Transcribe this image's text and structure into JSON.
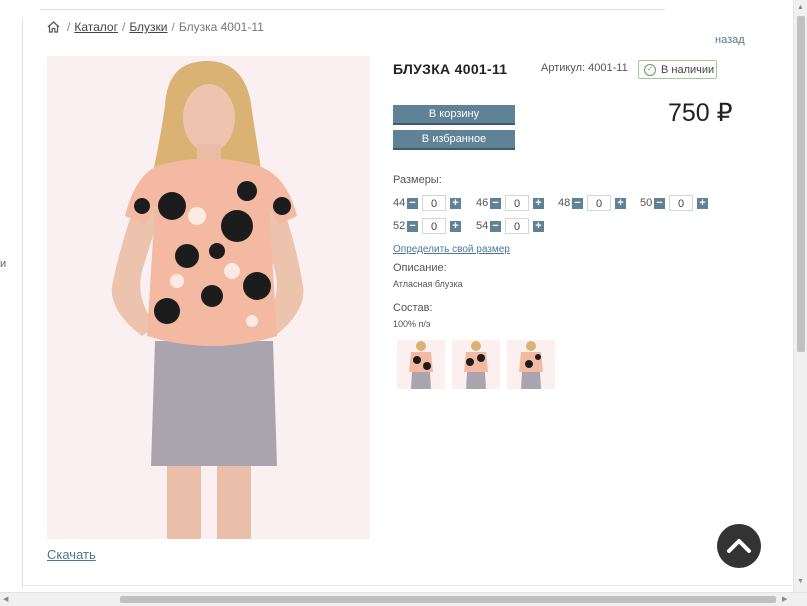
{
  "breadcrumb": {
    "home_icon": "home-icon",
    "separator": "/",
    "catalog": "Каталог",
    "category": "Блузки",
    "current": "Блузка 4001-11"
  },
  "back_link": "назад",
  "left_edge_char": "и",
  "product": {
    "title": "БЛУЗКА 4001-11",
    "article_label": "Артикул:",
    "article": "4001-11",
    "stock": "В наличии",
    "price": "750 ₽",
    "add_to_cart": "В корзину",
    "add_to_favorites": "В избранное",
    "sizes_label": "Размеры:",
    "sizes": [
      {
        "size": "44",
        "qty": "0"
      },
      {
        "size": "46",
        "qty": "0"
      },
      {
        "size": "48",
        "qty": "0"
      },
      {
        "size": "50",
        "qty": "0"
      },
      {
        "size": "52",
        "qty": "0"
      },
      {
        "size": "54",
        "qty": "0"
      }
    ],
    "size_link": "Определить свой размер",
    "description_label": "Описание:",
    "description": "Атласная блузка",
    "composition_label": "Состав:",
    "composition": "100% п/э",
    "download": "Скачать",
    "thumbnail_count": 3
  },
  "colors": {
    "button": "#5f8296",
    "link": "#4a7893",
    "stock_border": "#9ccf8f",
    "blouse_base": "#f3b9a2",
    "skirt": "#a9a4ad"
  },
  "icons": {
    "home": "home-icon",
    "check": "check-icon",
    "minus": "minus-icon",
    "plus": "plus-icon",
    "scroll_top": "chevron-up-icon"
  }
}
